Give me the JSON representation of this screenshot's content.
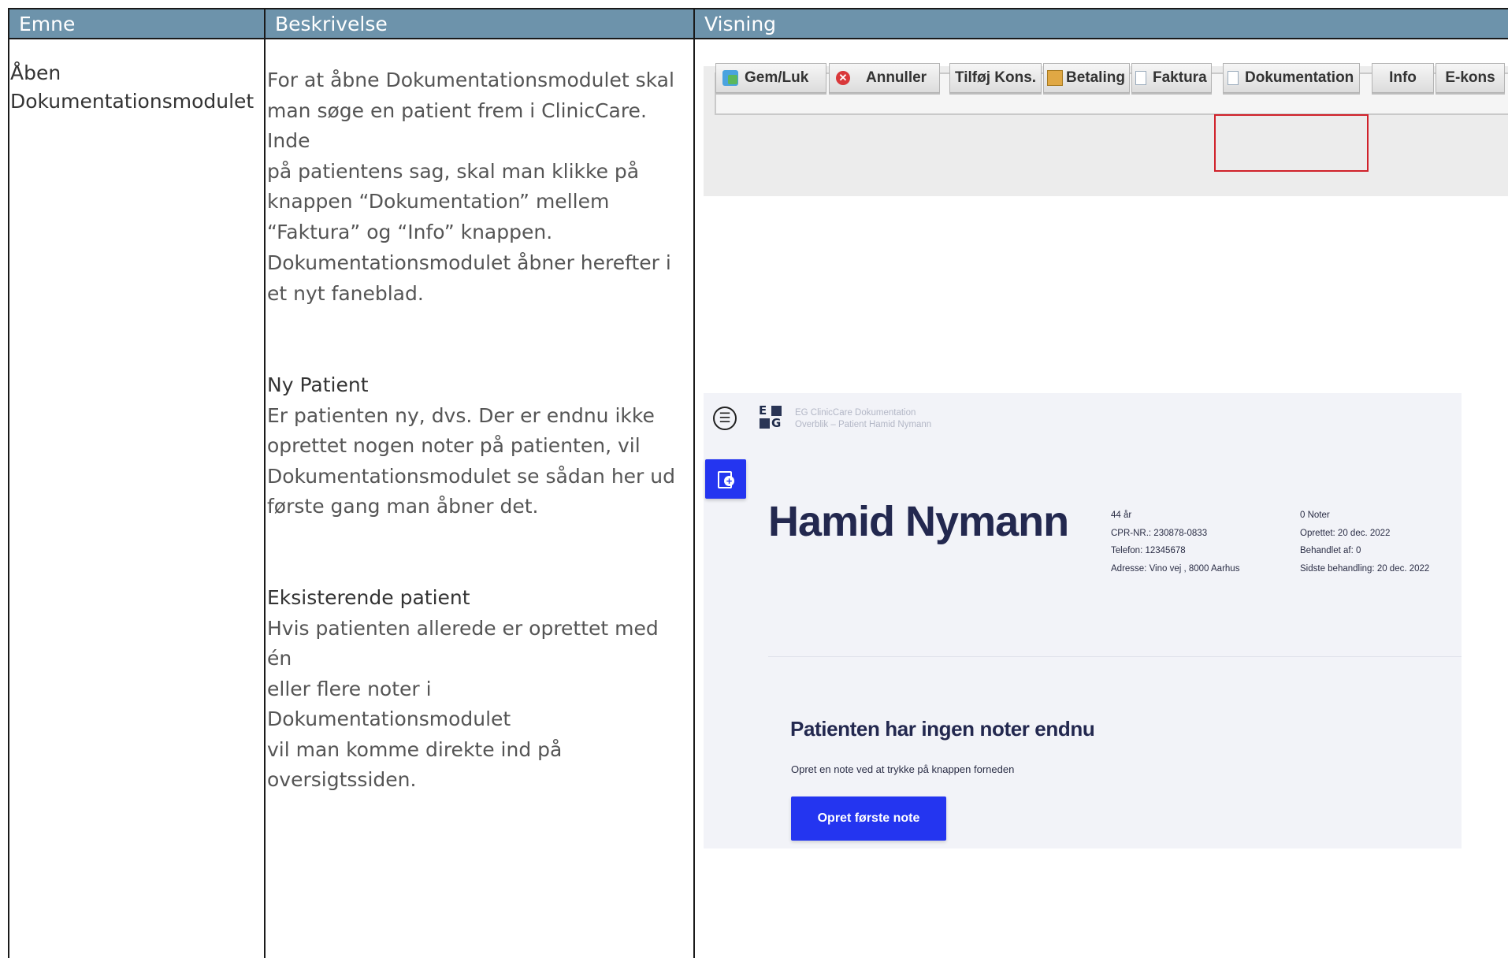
{
  "table": {
    "headers": [
      "Emne",
      "Beskrivelse",
      "Visning"
    ],
    "topic": [
      "Åben",
      "Dokumentationsmodulet"
    ],
    "description": {
      "intro": [
        "For at åbne Dokumentationsmodulet skal",
        "man søge en patient frem i ClinicCare. Inde",
        "på patientens sag, skal man klikke på",
        "knappen “Dokumentation” mellem",
        "“Faktura” og “Info” knappen."
      ],
      "after": [
        "Dokumentationsmodulet åbner herefter i",
        "et nyt faneblad."
      ],
      "new_patient_heading": "Ny Patient",
      "new_patient": [
        "Er patienten ny, dvs. Der er endnu ikke",
        "oprettet nogen noter på patienten, vil",
        "Dokumentationsmodulet se sådan her ud",
        "første gang man åbner det."
      ],
      "existing_heading": "Eksisterende patient",
      "existing": [
        "Hvis patienten allerede er oprettet med én",
        "eller flere noter i Dokumentationsmodulet",
        "vil man komme direkte ind på",
        "oversigtssiden."
      ]
    }
  },
  "toolbar": {
    "buttons": [
      "Gem/Luk",
      "Annuller",
      "Tilføj Kons.",
      "Betaling",
      "Faktura",
      "Dokumentation",
      "Info",
      "E-kons"
    ]
  },
  "docmodule": {
    "logo_top": "E",
    "logo_bottom": "G",
    "app_title": "EG ClinicCare Dokumentation",
    "breadcrumb": "Overblik – Patient Hamid Nymann",
    "patient_name": "Hamid Nymann",
    "info_left": [
      "44 år",
      "CPR-NR.: 230878-0833",
      "Telefon:  12345678",
      "Adresse:  Vino vej , 8000 Aarhus"
    ],
    "info_right": [
      "0  Noter",
      "Oprettet:  20 dec. 2022",
      "Behandlet af: 0",
      "Sidste behandling:  20 dec. 2022"
    ],
    "empty_title": "Patienten har ingen noter endnu",
    "empty_text": "Opret en note ved at trykke på knappen forneden",
    "cta_label": "Opret første note",
    "accent": "#2435f0",
    "name_color": "#23284f"
  }
}
